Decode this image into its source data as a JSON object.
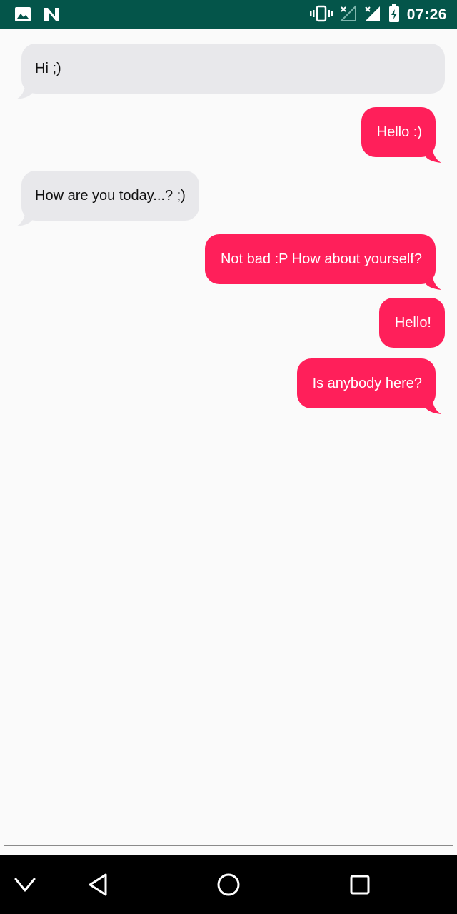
{
  "status_bar": {
    "time": "07:26",
    "left_icons": [
      "image-icon",
      "n-app-icon"
    ],
    "right_icons": [
      "vibrate-icon",
      "no-signal-icon",
      "cell-signal-icon",
      "battery-charging-icon"
    ],
    "background": "#04554a"
  },
  "messages": [
    {
      "direction": "incoming",
      "text": "Hi ;)"
    },
    {
      "direction": "outgoing",
      "text": "Hello :)"
    },
    {
      "direction": "incoming",
      "text": "How are you today...? ;)"
    },
    {
      "direction": "outgoing",
      "text": "Not bad :P How about yourself?"
    },
    {
      "direction": "outgoing",
      "text": "Hello!"
    },
    {
      "direction": "outgoing",
      "text": "Is anybody here?"
    }
  ],
  "colors": {
    "incoming_bubble": "#e8e8eb",
    "outgoing_bubble": "#ff1f5a",
    "background": "#fafafa"
  },
  "nav_bar": {
    "buttons": [
      "hide-keyboard-icon",
      "back-icon",
      "home-icon",
      "recents-icon"
    ]
  }
}
